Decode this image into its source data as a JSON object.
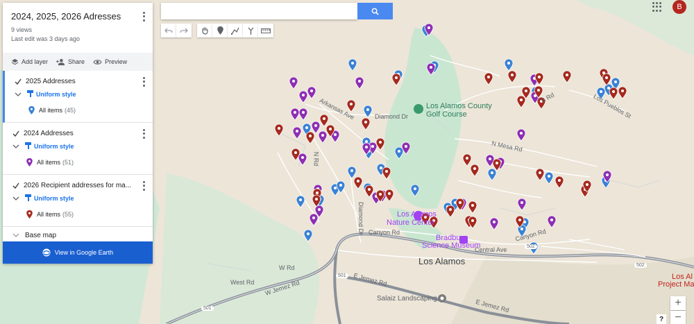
{
  "map_title": "2024, 2025, 2026 Adresses",
  "views": "9 views",
  "last_edit": "Last edit was 3 days ago",
  "actions": {
    "add_layer": "Add layer",
    "share": "Share",
    "preview": "Preview"
  },
  "layers": [
    {
      "name": "2025 Addresses",
      "style": "Uniform style",
      "items_label": "All items",
      "count": "(45)",
      "color": "#3b82d4"
    },
    {
      "name": "2024 Addresses",
      "style": "Uniform style",
      "items_label": "All items",
      "count": "(51)",
      "color": "#8e2fb3"
    },
    {
      "name": "2026 Recipient addresses for ma...",
      "style": "Uniform style",
      "items_label": "All items",
      "count": "(55)",
      "color": "#a52a1f"
    }
  ],
  "base_map": "Base map",
  "earth_button": "View in Google Earth",
  "search": {
    "placeholder": "",
    "value": ""
  },
  "avatar": "B",
  "zoom": {
    "in": "+",
    "out": "−"
  },
  "help": "?",
  "map_labels": {
    "golf": "Los Alamos County\nGolf Course",
    "golf1": "Los Alamos County",
    "golf2": "Golf Course",
    "nature1": "Los Alamos",
    "nature2": "Nature Center",
    "bradbury1": "Bradbury",
    "bradbury2": "Science Museum",
    "town": "Los Alamos",
    "arkansas": "Arkansas Ave",
    "diamond_dr": "Diamond Dr",
    "diamond_dr2": "Diamond Dr",
    "n_rd": "N Rd",
    "n_mesa": "N Mesa Rd",
    "canyon": "Canyon Rd",
    "canyon2": "Canyon Rd",
    "central": "Central Ave",
    "w_rd": "W Rd",
    "west_rd": "West Rd",
    "w_jemez": "W Jemez Rd",
    "e_jemez": "E Jemez Rd",
    "e_jemez2": "E Jemez Rd",
    "salaiz": "Salaiz Landscaping",
    "pueblos": "Los Pueblos St",
    "b_rd": "B Rd",
    "project1": "Los Al",
    "project2": "Project Mai",
    "hwy501": "501",
    "hwy502": "502",
    "hwy502b": "502",
    "hwy501b": "501",
    "w_rd2": "W Rd"
  },
  "pin_colors": {
    "blue": "#3b82d4",
    "purple": "#8e2fb3",
    "red": "#a52a1f"
  }
}
